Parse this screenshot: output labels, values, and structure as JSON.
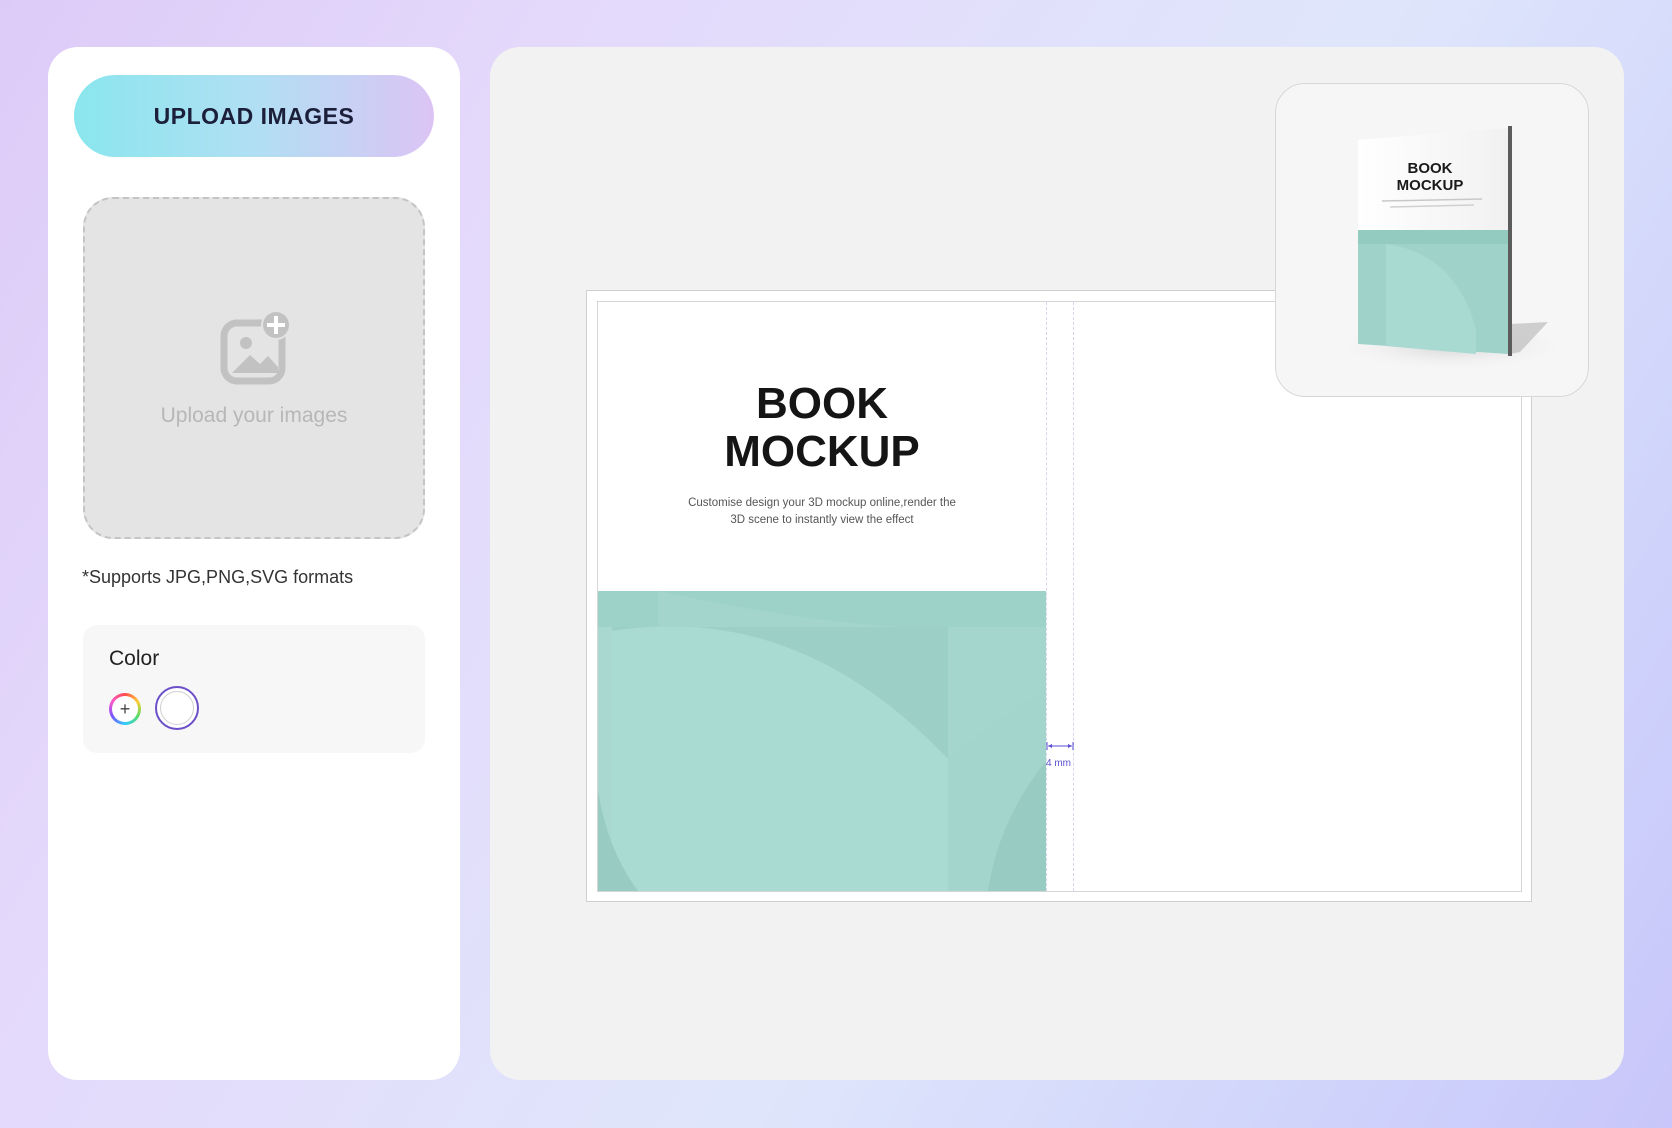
{
  "sidebar": {
    "upload_button_label": "UPLOAD IMAGES",
    "dropzone_label": "Upload your images",
    "formats_note": "*Supports JPG,PNG,SVG formats",
    "color_section": {
      "title": "Color",
      "add_symbol": "+",
      "selected_color": "#ffffff"
    }
  },
  "editor": {
    "cover": {
      "title_line1": "BOOK",
      "title_line2": "MOCKUP",
      "subtitle": "Customise design your 3D mockup online,render the 3D scene to instantly view the effect",
      "accent_color": "#a8d8d0"
    },
    "spine_label": "4 mm",
    "preview": {
      "title_line1": "BOOK",
      "title_line2": "MOCKUP"
    }
  }
}
